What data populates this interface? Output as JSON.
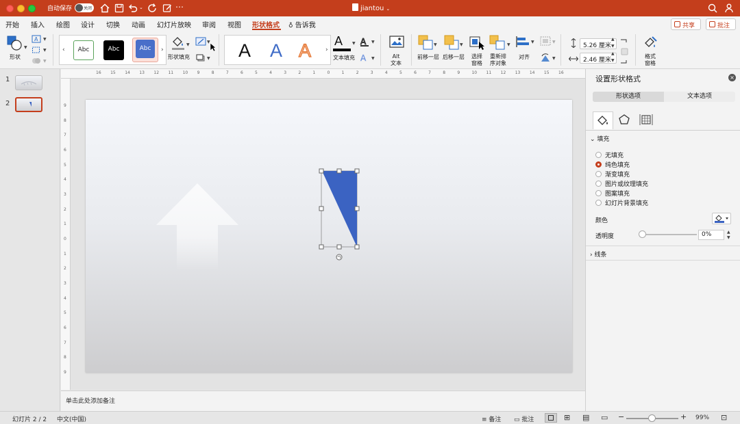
{
  "titlebar": {
    "autosave_label": "自动保存",
    "autosave_state": "关闭",
    "doc_title": "jiantou",
    "icons": [
      "home-icon",
      "save-icon",
      "undo-icon",
      "redo-icon",
      "edit-icon",
      "more-icon",
      "search-icon",
      "person-icon"
    ]
  },
  "menu": {
    "tabs": [
      "开始",
      "插入",
      "绘图",
      "设计",
      "切换",
      "动画",
      "幻灯片放映",
      "审阅",
      "视图",
      "形状格式",
      "告诉我"
    ],
    "active_tab": "形状格式",
    "share_label": "共享",
    "comment_label": "批注"
  },
  "ribbon": {
    "shapes_label": "形状",
    "style_chips": [
      "Abc",
      "Abc",
      "Abc"
    ],
    "shape_fill_label": "形状填充",
    "wordart_letters": [
      "A",
      "A",
      "A"
    ],
    "text_fill_label": "文本填充",
    "alt_text_label": "Alt\n文本",
    "bring_forward_label": "前移一层",
    "send_backward_label": "后移一层",
    "selection_pane_label": "选择\n窗格",
    "reorder_label": "重新排\n序对象",
    "align_label": "对齐",
    "height_value": "5.26 厘米",
    "width_value": "2.46 厘米",
    "format_pane_label": "格式\n窗格"
  },
  "thumbnails": [
    {
      "number": "1"
    },
    {
      "number": "2"
    }
  ],
  "ruler": {
    "h_ticks": [
      "16",
      "15",
      "14",
      "13",
      "12",
      "11",
      "10",
      "9",
      "8",
      "7",
      "6",
      "5",
      "4",
      "3",
      "2",
      "1",
      "0",
      "1",
      "2",
      "3",
      "4",
      "5",
      "6",
      "7",
      "8",
      "9",
      "10",
      "11",
      "12",
      "13",
      "14",
      "15",
      "16"
    ],
    "v_ticks": [
      "9",
      "8",
      "7",
      "6",
      "5",
      "4",
      "3",
      "2",
      "1",
      "0",
      "1",
      "2",
      "3",
      "4",
      "5",
      "6",
      "7",
      "8",
      "9"
    ]
  },
  "slide": {
    "shape_color": "#3b63c2"
  },
  "notes": {
    "placeholder": "单击此处添加备注"
  },
  "panel": {
    "title": "设置形状格式",
    "tab_shape": "形状选项",
    "tab_text": "文本选项",
    "fill_section": "填充",
    "fill_options": [
      "无填充",
      "纯色填充",
      "渐变填充",
      "图片或纹理填充",
      "图案填充",
      "幻灯片背景填充"
    ],
    "selected_fill": "纯色填充",
    "color_label": "颜色",
    "transparency_label": "透明度",
    "transparency_value": "0%",
    "transparency_fraction": 0,
    "line_section": "线条"
  },
  "statusbar": {
    "slide_info": "幻灯片 2 / 2",
    "language": "中文(中国)",
    "notes_label": "备注",
    "comments_label": "批注",
    "zoom_value": "99%",
    "zoom_fraction": 0.5
  },
  "colors": {
    "accent": "#c43e1c",
    "shape_blue": "#3b63c2"
  }
}
